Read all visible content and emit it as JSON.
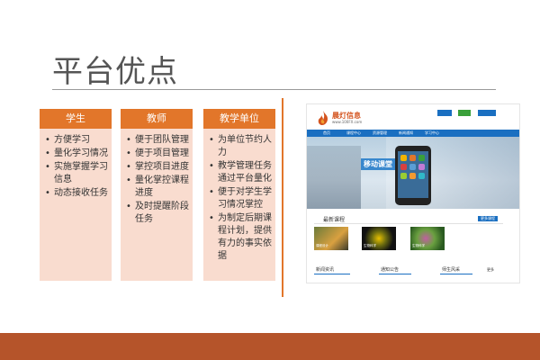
{
  "title": "平台优点",
  "columns": [
    {
      "header": "学生",
      "items": [
        "方便学习",
        "量化学习情况",
        "实施掌握学习信息",
        "动态接收任务"
      ]
    },
    {
      "header": "教师",
      "items": [
        "便于团队管理",
        "便于项目管理",
        "掌控项目进度",
        "量化掌控课程进度",
        "及时提醒阶段任务"
      ]
    },
    {
      "header": "教学单位",
      "items": [
        "为单位节约人力",
        "教学管理任务通过平台量化",
        "便于对学生学习情况掌控",
        "为制定后期课程计划，提供有力的事实依据"
      ]
    }
  ],
  "colors": {
    "accent": "#e2762a",
    "panel": "#f9dccf",
    "footer": "#b5542a",
    "site_nav": "#1a6fc1"
  },
  "website": {
    "logo": "晨灯信息",
    "url": "www.100FX.com",
    "nav": [
      "首页",
      "课程中心",
      "资源管理",
      "新闻通知",
      "学习中心"
    ],
    "slogan": "移动课堂  自在学习",
    "section_course": "最新课程",
    "more": "更多课程",
    "thumbs": [
      "课程设计",
      "生物科学",
      "生物科学"
    ],
    "tabs": [
      "新闻资讯",
      "通知公告",
      "师生风采"
    ],
    "tab_more": "更多"
  }
}
